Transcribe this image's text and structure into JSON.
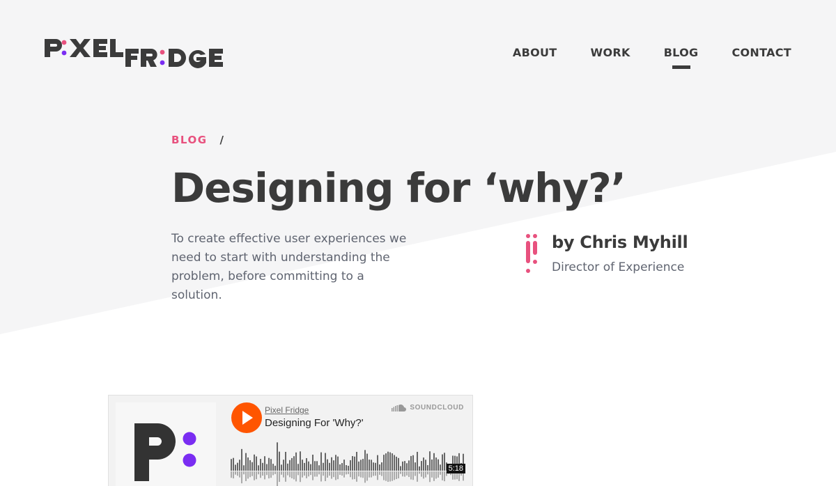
{
  "brand": {
    "logo_alt": "Pixel Fridge",
    "accent_pink": "#e8517e",
    "accent_purple": "#7a2df2",
    "text_dark": "#3b3b3b",
    "text_muted": "#5f6470"
  },
  "nav": {
    "items": [
      {
        "label": "ABOUT",
        "active": false
      },
      {
        "label": "WORK",
        "active": false
      },
      {
        "label": "BLOG",
        "active": true
      },
      {
        "label": "CONTACT",
        "active": false
      }
    ]
  },
  "breadcrumb": {
    "link": "BLOG",
    "separator": "/"
  },
  "article": {
    "title": "Designing for ‘why?’",
    "intro": "To create effective user experiences we need to start with understanding the problem, before committing to a solution.",
    "author_name": "by Chris Myhill",
    "author_role": "Director of Experience"
  },
  "player": {
    "user": "Pixel Fridge",
    "track_title": "Designing For 'Why?'",
    "brand_label": "SOUNDCLOUD",
    "duration": "5:18",
    "play_color": "#ff5500"
  }
}
